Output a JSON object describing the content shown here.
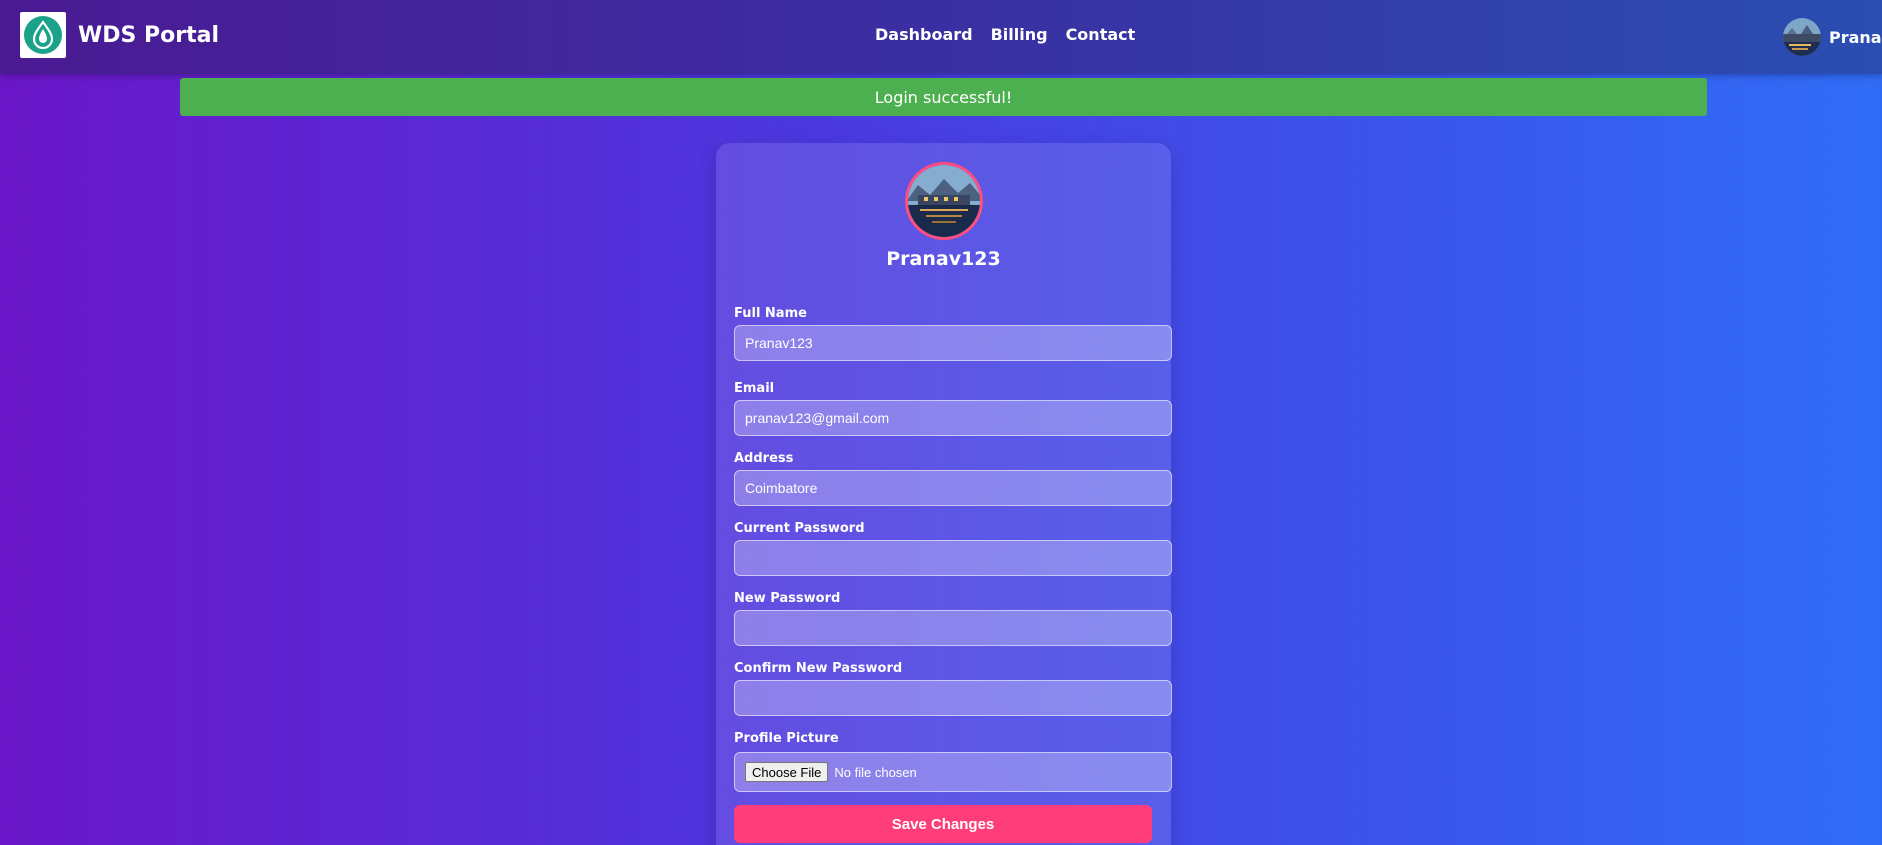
{
  "navbar": {
    "brand_title": "WDS Portal",
    "logo_icon": "water-drop-icon",
    "links": [
      "Dashboard",
      "Billing",
      "Contact"
    ],
    "user_name": "Pranav"
  },
  "alert": {
    "message": "Login successful!",
    "color": "#4caf50"
  },
  "profile": {
    "username": "Pranav123",
    "fields": {
      "full_name": {
        "label": "Full Name",
        "value": "Pranav123"
      },
      "email": {
        "label": "Email",
        "value": "pranav123@gmail.com"
      },
      "address": {
        "label": "Address",
        "value": "Coimbatore"
      },
      "current_password": {
        "label": "Current Password",
        "value": ""
      },
      "new_password": {
        "label": "New Password",
        "value": ""
      },
      "confirm_password": {
        "label": "Confirm New Password",
        "value": ""
      },
      "profile_picture": {
        "label": "Profile Picture",
        "button": "Choose File",
        "status": "No file chosen"
      }
    },
    "save_label": "Save Changes"
  },
  "colors": {
    "accent": "#ff3d7a",
    "success": "#4caf50",
    "brand_logo": "#1aa28a"
  }
}
